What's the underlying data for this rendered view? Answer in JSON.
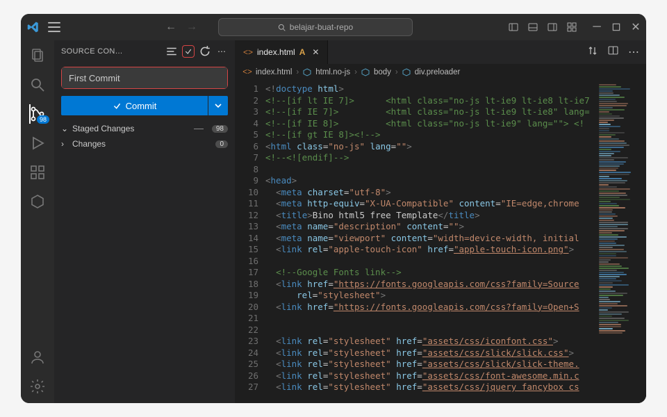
{
  "titlebar": {
    "search_placeholder": "belajar-buat-repo"
  },
  "activitybar": {
    "scm_badge": "98"
  },
  "sidebar": {
    "title": "SOURCE CON…",
    "commit_message": "First Commit",
    "commit_button": "Commit",
    "groups": [
      {
        "label": "Staged Changes",
        "count": "98",
        "show_dash": true,
        "expanded": true
      },
      {
        "label": "Changes",
        "count": "0",
        "show_dash": false,
        "expanded": false
      }
    ]
  },
  "tab": {
    "filename": "index.html",
    "modified_indicator": "A"
  },
  "breadcrumb": [
    {
      "icon": "file-html",
      "label": "index.html"
    },
    {
      "icon": "cube",
      "label": "html.no-js"
    },
    {
      "icon": "cube",
      "label": "body"
    },
    {
      "icon": "cube",
      "label": "div.preloader"
    }
  ],
  "code_lines": [
    {
      "n": 1,
      "html": "<span class='c-punc'>&lt;!</span><span class='c-doctype'>doctype</span> <span class='c-attr'>html</span><span class='c-punc'>&gt;</span>"
    },
    {
      "n": 2,
      "html": "<span class='c-comment'>&lt;!--[if lt IE 7]&gt;</span>      <span class='c-comment'>&lt;html class=&quot;no-js lt-ie9 lt-ie8 lt-ie7</span>"
    },
    {
      "n": 3,
      "html": "<span class='c-comment'>&lt;!--[if IE 7]&gt;</span>         <span class='c-comment'>&lt;html class=&quot;no-js lt-ie9 lt-ie8&quot; lang=</span>"
    },
    {
      "n": 4,
      "html": "<span class='c-comment'>&lt;!--[if IE 8]&gt;</span>         <span class='c-comment'>&lt;html class=&quot;no-js lt-ie9&quot; lang=&quot;&quot;&gt; &lt;!</span>"
    },
    {
      "n": 5,
      "html": "<span class='c-comment'>&lt;!--[if gt IE 8]&gt;&lt;!--&gt;</span>"
    },
    {
      "n": 6,
      "html": "<span class='c-punc'>&lt;</span><span class='c-tag'>html</span> <span class='c-attr'>class</span>=<span class='c-string'>&quot;no-js&quot;</span> <span class='c-attr'>lang</span>=<span class='c-string'>&quot;&quot;</span><span class='c-punc'>&gt;</span>"
    },
    {
      "n": 7,
      "html": "<span class='c-comment'>&lt;!--&lt;![endif]--&gt;</span>"
    },
    {
      "n": 8,
      "html": ""
    },
    {
      "n": 9,
      "html": "<span class='c-punc'>&lt;</span><span class='c-tag'>head</span><span class='c-punc'>&gt;</span>"
    },
    {
      "n": 10,
      "html": "  <span class='c-punc'>&lt;</span><span class='c-tag'>meta</span> <span class='c-attr'>charset</span>=<span class='c-string'>&quot;utf-8&quot;</span><span class='c-punc'>&gt;</span>"
    },
    {
      "n": 11,
      "html": "  <span class='c-punc'>&lt;</span><span class='c-tag'>meta</span> <span class='c-attr'>http-equiv</span>=<span class='c-string'>&quot;X-UA-Compatible&quot;</span> <span class='c-attr'>content</span>=<span class='c-string'>&quot;IE=edge,chrome</span>"
    },
    {
      "n": 12,
      "html": "  <span class='c-punc'>&lt;</span><span class='c-tag'>title</span><span class='c-punc'>&gt;</span>Bino html5 free Template<span class='c-punc'>&lt;/</span><span class='c-tag'>title</span><span class='c-punc'>&gt;</span>"
    },
    {
      "n": 13,
      "html": "  <span class='c-punc'>&lt;</span><span class='c-tag'>meta</span> <span class='c-attr'>name</span>=<span class='c-string'>&quot;description&quot;</span> <span class='c-attr'>content</span>=<span class='c-string'>&quot;&quot;</span><span class='c-punc'>&gt;</span>"
    },
    {
      "n": 14,
      "html": "  <span class='c-punc'>&lt;</span><span class='c-tag'>meta</span> <span class='c-attr'>name</span>=<span class='c-string'>&quot;viewport&quot;</span> <span class='c-attr'>content</span>=<span class='c-string'>&quot;width=device-width, initial</span>"
    },
    {
      "n": 15,
      "html": "  <span class='c-punc'>&lt;</span><span class='c-tag'>link</span> <span class='c-attr'>rel</span>=<span class='c-string'>&quot;apple-touch-icon&quot;</span> <span class='c-attr'>href</span>=<span class='c-string c-underline'>&quot;apple-touch-icon.png&quot;</span><span class='c-punc'>&gt;</span>"
    },
    {
      "n": 16,
      "html": ""
    },
    {
      "n": 17,
      "html": "  <span class='c-comment'>&lt;!--Google Fonts link--&gt;</span>"
    },
    {
      "n": 18,
      "html": "  <span class='c-punc'>&lt;</span><span class='c-tag'>link</span> <span class='c-attr'>href</span>=<span class='c-string c-underline'>&quot;https://fonts.googleapis.com/css?family=Source</span>"
    },
    {
      "n": 19,
      "html": "      <span class='c-attr'>rel</span>=<span class='c-string'>&quot;stylesheet&quot;</span><span class='c-punc'>&gt;</span>"
    },
    {
      "n": 20,
      "html": "  <span class='c-punc'>&lt;</span><span class='c-tag'>link</span> <span class='c-attr'>href</span>=<span class='c-string c-underline'>&quot;https://fonts.googleapis.com/css?family=Open+S</span>"
    },
    {
      "n": 21,
      "html": ""
    },
    {
      "n": 22,
      "html": ""
    },
    {
      "n": 23,
      "html": "  <span class='c-punc'>&lt;</span><span class='c-tag'>link</span> <span class='c-attr'>rel</span>=<span class='c-string'>&quot;stylesheet&quot;</span> <span class='c-attr'>href</span>=<span class='c-string c-underline'>&quot;assets/css/iconfont.css&quot;</span><span class='c-punc'>&gt;</span>"
    },
    {
      "n": 24,
      "html": "  <span class='c-punc'>&lt;</span><span class='c-tag'>link</span> <span class='c-attr'>rel</span>=<span class='c-string'>&quot;stylesheet&quot;</span> <span class='c-attr'>href</span>=<span class='c-string c-underline'>&quot;assets/css/slick/slick.css&quot;</span><span class='c-punc'>&gt;</span>"
    },
    {
      "n": 25,
      "html": "  <span class='c-punc'>&lt;</span><span class='c-tag'>link</span> <span class='c-attr'>rel</span>=<span class='c-string'>&quot;stylesheet&quot;</span> <span class='c-attr'>href</span>=<span class='c-string c-underline'>&quot;assets/css/slick/slick-theme.</span>"
    },
    {
      "n": 26,
      "html": "  <span class='c-punc'>&lt;</span><span class='c-tag'>link</span> <span class='c-attr'>rel</span>=<span class='c-string'>&quot;stylesheet&quot;</span> <span class='c-attr'>href</span>=<span class='c-string c-underline'>&quot;assets/css/font-awesome.min.c</span>"
    },
    {
      "n": 27,
      "html": "  <span class='c-punc'>&lt;</span><span class='c-tag'>link</span> <span class='c-attr'>rel</span>=<span class='c-string'>&quot;stylesheet&quot;</span> <span class='c-attr'>href</span>=<span class='c-string c-underline'>&quot;assets/css/jquery fancybox cs</span>"
    }
  ]
}
